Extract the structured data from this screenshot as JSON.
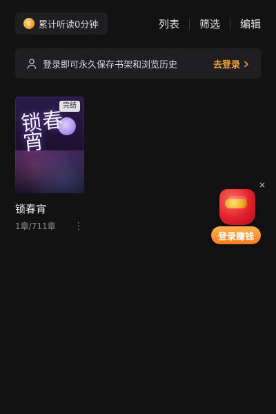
{
  "top": {
    "listen_pill": {
      "text": "累计听读0分钟",
      "icon": "coin-icon"
    },
    "actions": [
      {
        "label": "列表"
      },
      {
        "label": "筛选"
      },
      {
        "label": "编辑"
      }
    ]
  },
  "login_banner": {
    "icon": "user-icon",
    "text": "登录即可永久保存书架和浏览历史",
    "link_label": "去登录",
    "link_icon": "chevron-right-icon",
    "accent": "#f2a23a"
  },
  "books": [
    {
      "cover_art_text": "锁春宵",
      "badge": "完结",
      "title": "锁春宵",
      "progress": "1章/711章",
      "more_icon": "more-icon"
    }
  ],
  "floating_reward": {
    "close_label": "×",
    "button_label": "登录赚钱",
    "icon": "red-packet-icon"
  },
  "colors": {
    "background": "#121212",
    "card": "#1f1f22",
    "text": "#e6e6e6",
    "muted": "#8b8b8b",
    "orange_button": "#ff7a1d",
    "red_packet": "#e11f2b"
  }
}
